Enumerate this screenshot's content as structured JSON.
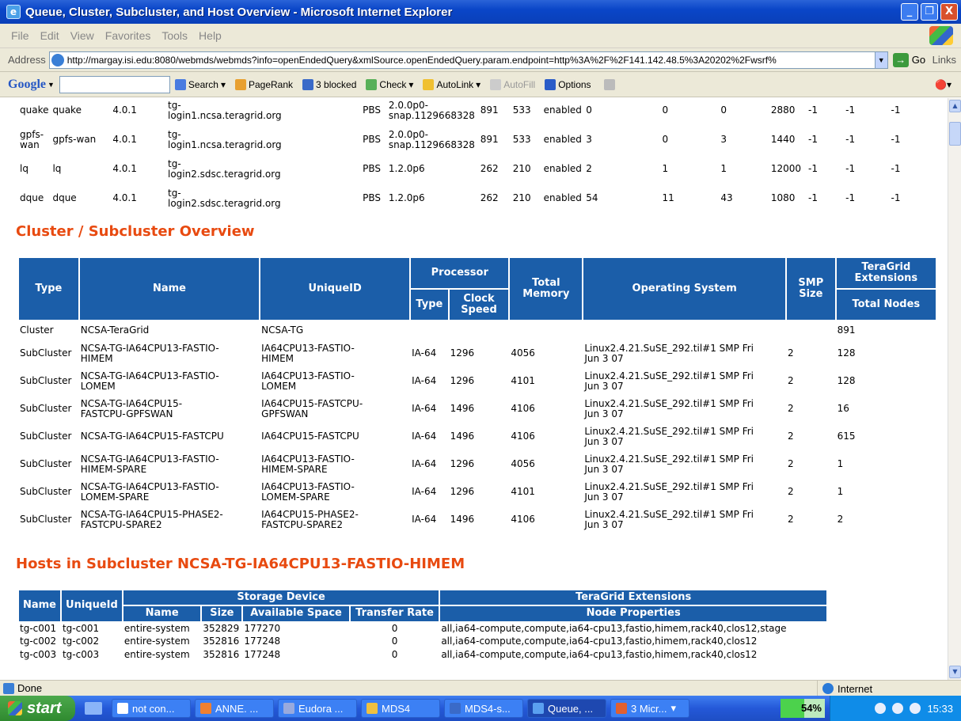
{
  "window": {
    "title": "Queue, Cluster, Subcluster, and Host Overview - Microsoft Internet Explorer",
    "buttons": [
      "_",
      "❐",
      "X"
    ]
  },
  "menu": [
    "File",
    "Edit",
    "View",
    "Favorites",
    "Tools",
    "Help"
  ],
  "address": {
    "label": "Address",
    "url": "http://margay.isi.edu:8080/webmds/webmds?info=openEndedQuery&xmlSource.openEndedQuery.param.endpoint=http%3A%2F%2F141.142.48.5%3A20202%2Fwsrf%",
    "go": "Go",
    "links": "Links"
  },
  "google_toolbar": {
    "logo": "Google",
    "search": "Search",
    "pagerank": "PageRank",
    "blocked": "3 blocked",
    "check": "Check",
    "autolink": "AutoLink",
    "autofill": "AutoFill",
    "options": "Options"
  },
  "queues": {
    "rows": [
      [
        "quake",
        "quake",
        "4.0.1",
        "tg-\nlogin1.ncsa.teragrid.org",
        "PBS",
        "2.0.0p0-\nsnap.1129668328",
        "891",
        "533",
        "enabled",
        "0",
        "0",
        "0",
        "2880",
        "-1",
        "-1",
        "-1"
      ],
      [
        "gpfs-\nwan",
        "gpfs-wan",
        "4.0.1",
        "tg-\nlogin1.ncsa.teragrid.org",
        "PBS",
        "2.0.0p0-\nsnap.1129668328",
        "891",
        "533",
        "enabled",
        "3",
        "0",
        "3",
        "1440",
        "-1",
        "-1",
        "-1"
      ],
      [
        "lq",
        "lq",
        "4.0.1",
        "tg-\nlogin2.sdsc.teragrid.org",
        "PBS",
        "1.2.0p6",
        "262",
        "210",
        "enabled",
        "2",
        "1",
        "1",
        "12000",
        "-1",
        "-1",
        "-1"
      ],
      [
        "dque",
        "dque",
        "4.0.1",
        "tg-\nlogin2.sdsc.teragrid.org",
        "PBS",
        "1.2.0p6",
        "262",
        "210",
        "enabled",
        "54",
        "11",
        "43",
        "1080",
        "-1",
        "-1",
        "-1"
      ]
    ]
  },
  "cluster_section": {
    "title": "Cluster / Subcluster Overview",
    "headers": {
      "type": "Type",
      "name": "Name",
      "uniqueid": "UniqueID",
      "processor": "Processor",
      "proc_type": "Type",
      "clock": "Clock Speed",
      "memory": "Total Memory",
      "os": "Operating System",
      "smp": "SMP Size",
      "tg_ext": "TeraGrid Extensions",
      "nodes": "Total Nodes"
    },
    "rows": [
      [
        "Cluster",
        "NCSA-TeraGrid",
        "NCSA-TG",
        "",
        "",
        "",
        "",
        "",
        "891"
      ],
      [
        "SubCluster",
        "NCSA-TG-IA64CPU13-FASTIO-\nHIMEM",
        "IA64CPU13-FASTIO-\nHIMEM",
        "IA-64",
        "1296",
        "4056",
        "Linux2.4.21.SuSE_292.til#1 SMP Fri\nJun 3 07",
        "2",
        "128"
      ],
      [
        "SubCluster",
        "NCSA-TG-IA64CPU13-FASTIO-\nLOMEM",
        "IA64CPU13-FASTIO-\nLOMEM",
        "IA-64",
        "1296",
        "4101",
        "Linux2.4.21.SuSE_292.til#1 SMP Fri\nJun 3 07",
        "2",
        "128"
      ],
      [
        "SubCluster",
        "NCSA-TG-IA64CPU15-\nFASTCPU-GPFSWAN",
        "IA64CPU15-FASTCPU-\nGPFSWAN",
        "IA-64",
        "1496",
        "4106",
        "Linux2.4.21.SuSE_292.til#1 SMP Fri\nJun 3 07",
        "2",
        "16"
      ],
      [
        "SubCluster",
        "NCSA-TG-IA64CPU15-FASTCPU",
        "IA64CPU15-FASTCPU",
        "IA-64",
        "1496",
        "4106",
        "Linux2.4.21.SuSE_292.til#1 SMP Fri\nJun 3 07",
        "2",
        "615"
      ],
      [
        "SubCluster",
        "NCSA-TG-IA64CPU13-FASTIO-\nHIMEM-SPARE",
        "IA64CPU13-FASTIO-\nHIMEM-SPARE",
        "IA-64",
        "1296",
        "4056",
        "Linux2.4.21.SuSE_292.til#1 SMP Fri\nJun 3 07",
        "2",
        "1"
      ],
      [
        "SubCluster",
        "NCSA-TG-IA64CPU13-FASTIO-\nLOMEM-SPARE",
        "IA64CPU13-FASTIO-\nLOMEM-SPARE",
        "IA-64",
        "1296",
        "4101",
        "Linux2.4.21.SuSE_292.til#1 SMP Fri\nJun 3 07",
        "2",
        "1"
      ],
      [
        "SubCluster",
        "NCSA-TG-IA64CPU15-PHASE2-\nFASTCPU-SPARE2",
        "IA64CPU15-PHASE2-\nFASTCPU-SPARE2",
        "IA-64",
        "1496",
        "4106",
        "Linux2.4.21.SuSE_292.til#1 SMP Fri\nJun 3 07",
        "2",
        "2"
      ]
    ]
  },
  "hosts_section": {
    "title": "Hosts in Subcluster NCSA-TG-IA64CPU13-FASTIO-HIMEM",
    "headers": {
      "name": "Name",
      "uniqueid": "UniqueId",
      "storage": "Storage Device",
      "tg_ext": "TeraGrid Extensions",
      "sname": "Name",
      "size": "Size",
      "avail": "Available Space",
      "rate": "Transfer Rate",
      "props": "Node Properties"
    },
    "rows": [
      [
        "tg-c001",
        "tg-c001",
        "entire-system",
        "352829",
        "177270",
        "0",
        "all,ia64-compute,compute,ia64-cpu13,fastio,himem,rack40,clos12,stage"
      ],
      [
        "tg-c002",
        "tg-c002",
        "entire-system",
        "352816",
        "177248",
        "0",
        "all,ia64-compute,compute,ia64-cpu13,fastio,himem,rack40,clos12"
      ],
      [
        "tg-c003",
        "tg-c003",
        "entire-system",
        "352816",
        "177248",
        "0",
        "all,ia64-compute,compute,ia64-cpu13,fastio,himem,rack40,clos12"
      ]
    ]
  },
  "status": {
    "text": "Done",
    "zone": "Internet"
  },
  "taskbar": {
    "start": "start",
    "tasks": [
      "not con...",
      "ANNE. ...",
      "Eudora ...",
      "MDS4",
      "MDS4-s...",
      "Queue, ...",
      "3 Micr..."
    ],
    "meter_percent": 54,
    "meter_label": "54%",
    "clock": "15:33"
  }
}
